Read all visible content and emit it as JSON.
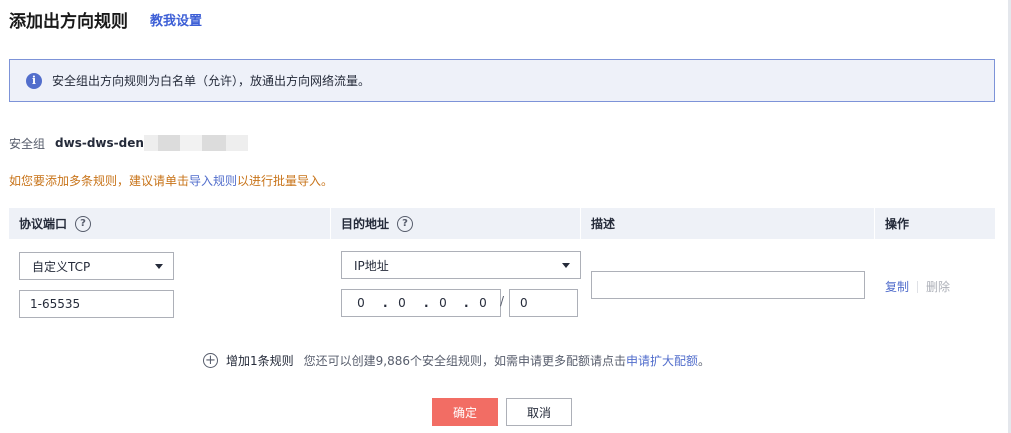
{
  "header": {
    "title": "添加出方向规则",
    "tutorial_link": "教我设置"
  },
  "info": {
    "icon": "info-icon",
    "text": "安全组出方向规则为白名单（允许），放通出方向网络流量。"
  },
  "security_group": {
    "label": "安全组",
    "name": "dws-dws-den"
  },
  "hint": {
    "prefix": "如您要添加多条规则，建议请单击",
    "link": "导入规则",
    "suffix": "以进行批量导入。"
  },
  "table": {
    "columns": [
      {
        "label": "协议端口",
        "help": true
      },
      {
        "label": "目的地址",
        "help": true
      },
      {
        "label": "描述",
        "help": false
      },
      {
        "label": "操作",
        "help": false
      }
    ],
    "rows": [
      {
        "protocol": "自定义TCP",
        "port": "1-65535",
        "address_type": "IP地址",
        "ip_octets": [
          "0",
          "0",
          "0",
          "0"
        ],
        "mask": "0",
        "description": "",
        "actions": {
          "copy": "复制",
          "delete": "删除"
        }
      }
    ]
  },
  "add_rule": {
    "label": "增加1条规则",
    "quota_prefix": "您还可以创建9,886个安全组规则，如需申请更多配额请点击",
    "quota_link": "申请扩大配额",
    "quota_suffix": "。"
  },
  "buttons": {
    "ok": "确定",
    "cancel": "取消"
  },
  "colors": {
    "primary_button": "#f26d64",
    "link": "#526ecc",
    "hint_text": "#c8741a",
    "info_border": "#7d93d8"
  }
}
